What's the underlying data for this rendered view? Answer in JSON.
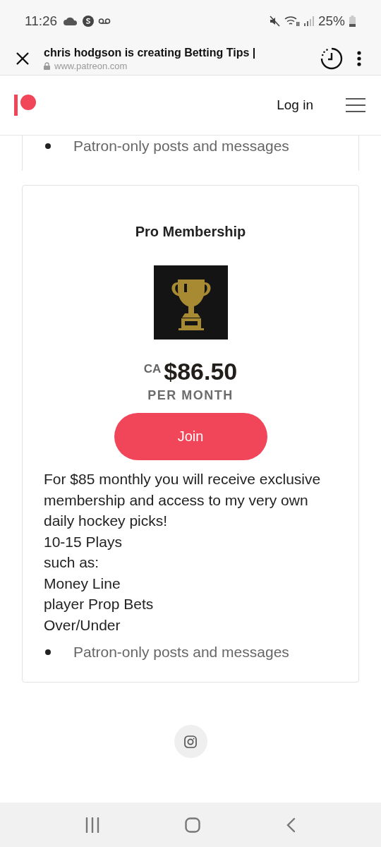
{
  "status_bar": {
    "time": "11:26",
    "battery": "25%"
  },
  "browser": {
    "title": "chris hodgson is creating Betting Tips |",
    "url": "www.patreon.com"
  },
  "header": {
    "login": "Log in"
  },
  "previous_tier": {
    "benefits": [
      "Patron-only posts and messages"
    ]
  },
  "tier": {
    "name": "Pro Membership",
    "currency": "CA",
    "price": "$86.50",
    "period": "PER MONTH",
    "button": "Join",
    "description": [
      "For $85 monthly you will receive exclusive membership and access to my very own daily hockey picks!",
      "10-15 Plays",
      "such as:",
      "Money Line",
      "player Prop Bets",
      "Over/Under"
    ],
    "benefits": [
      "Patron-only posts and messages"
    ]
  }
}
